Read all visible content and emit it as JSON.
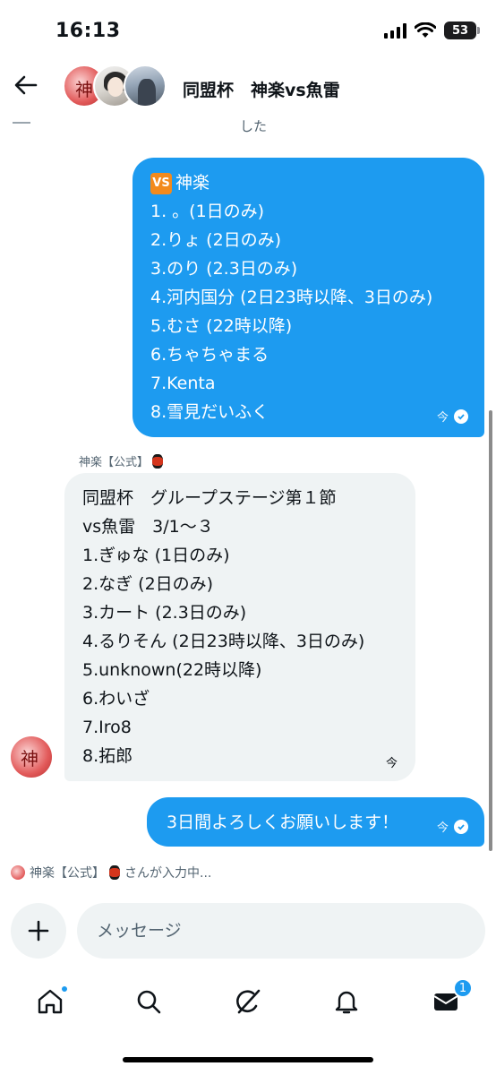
{
  "status_bar": {
    "time": "16:13",
    "battery": "53"
  },
  "header": {
    "title": "同盟杯　神楽vs魚雷"
  },
  "conversation": {
    "cut_off_text": "した",
    "message1": {
      "lines": [
        "神楽",
        "1. 。(1日のみ)",
        "2.りょ (2日のみ)",
        "3.のり (2.3日のみ)",
        "4.河内国分 (2日23時以降、3日のみ)",
        "5.むさ (22時以降)",
        "6.ちゃちゃまる",
        "7.Kenta",
        "8.雪見だいふく"
      ],
      "vs_badge": "VS",
      "time": "今"
    },
    "sender": {
      "name": "神楽【公式】"
    },
    "message2": {
      "lines": [
        "同盟杯　グループステージ第１節",
        "vs魚雷　3/1〜３",
        "1.ぎゅな (1日のみ)",
        "2.なぎ (2日のみ)",
        "3.カート (2.3日のみ)",
        "4.るりそん (2日23時以降、3日のみ)",
        "5.unknown(22時以降)",
        "6.わいざ",
        "7.Iro8",
        "8.拓郎"
      ],
      "time": "今"
    },
    "message3": {
      "text": "3日間よろしくお願いします！",
      "time": "今"
    },
    "typing": {
      "name": "神楽【公式】",
      "suffix": "さんが入力中..."
    }
  },
  "composer": {
    "placeholder": "メッセージ"
  },
  "tab_bar": {
    "messages_badge": "1"
  },
  "colors": {
    "accent": "#1d9bf0",
    "incoming_bubble": "#eff3f4",
    "badge_orange": "#f28a1d"
  }
}
